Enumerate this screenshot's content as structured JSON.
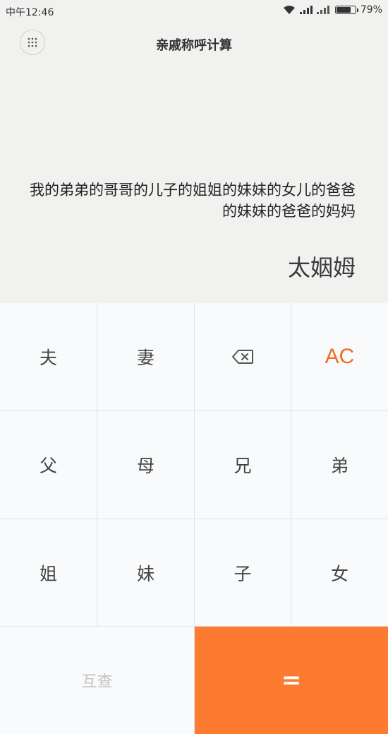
{
  "status_bar": {
    "time": "中午12:46",
    "battery": "79%",
    "battery_level": 0.79
  },
  "header": {
    "title": "亲戚称呼计算",
    "menu_icon": "grid-dots-icon"
  },
  "display": {
    "expression": "我的弟弟的哥哥的儿子的姐姐的妹妹的女儿的爸爸的妹妹的爸爸的妈妈",
    "result": "太姻姆"
  },
  "keypad": {
    "keys": {
      "husband": "夫",
      "wife": "妻",
      "backspace_icon": "backspace-icon",
      "clear": "AC",
      "father": "父",
      "mother": "母",
      "older_brother": "兄",
      "younger_brother": "弟",
      "older_sister": "姐",
      "younger_sister": "妹",
      "son": "子",
      "daughter": "女",
      "mutual_check": "互查",
      "equals": "="
    }
  },
  "colors": {
    "accent": "#fd7a31",
    "ac_text": "#f26b21",
    "display_bg": "#f1f1f0",
    "keypad_bg": "#f9fafb"
  }
}
